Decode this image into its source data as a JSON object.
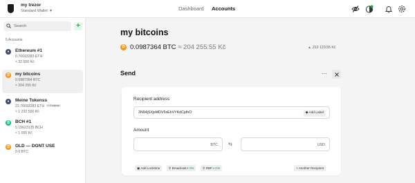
{
  "device": {
    "name": "my trezor",
    "wallet": "Standard Wallet"
  },
  "nav": {
    "dashboard": "Dashboard",
    "accounts": "Accounts"
  },
  "icons": {
    "topbar": [
      "hide-balances-icon",
      "tor-icon",
      "notifications-bell-icon",
      "settings-gear-icon"
    ],
    "search": "search-icon",
    "close": "close-icon"
  },
  "sidebar": {
    "search_placeholder": "Search",
    "add_label": "+",
    "accounts_count": "5 Accounts",
    "accounts": [
      {
        "name": "Ethereum #1",
        "balance": "0.76693283 ETH",
        "fiat": "≈ 32 500 Kč",
        "coin": "ETH",
        "coin_symbol": "♦",
        "color": "#454a75"
      },
      {
        "name": "my bitcoins",
        "balance": "0.0987364 BTC",
        "fiat": "≈ 204 255 Kč",
        "coin": "BTC",
        "coin_symbol": "₿",
        "color": "#f7931a"
      },
      {
        "name": "Meine Tokenss",
        "balance": "22.76693283 ETH",
        "badge": "+ 4 tokens",
        "fiat": "≈ 1 232 500 Kč",
        "coin": "ETH",
        "coin_symbol": "♦",
        "color": "#454a75"
      },
      {
        "name": "BCH #1",
        "balance": "0.15623135 BCH",
        "fiat": "≈ 1 000 Kč",
        "coin": "BCH",
        "coin_symbol": "₿",
        "color": "#0ac18e"
      },
      {
        "name": "OLD — DONT USE",
        "balance": "0.0 BTC",
        "coin": "BTC",
        "coin_symbol": "₿",
        "color": "#f7931a"
      }
    ]
  },
  "account": {
    "title": "my bitcoins",
    "balance": "0.0987364 BTC",
    "fiat": "≈ 204 255.55 Kč",
    "change": "212 123.55 Kč"
  },
  "send": {
    "title": "Send",
    "more": "⋯",
    "recipient_label": "Recipient address",
    "address": "3N94jSXjsMDV5xEhVYKdCjdhO",
    "add_label": "Add Label",
    "amount_label": "Amount",
    "amount_unit_crypto": "BTC",
    "amount_unit_fiat": "USD",
    "swap_symbol": "⇆",
    "options": {
      "locktime": "Add Locktime",
      "broadcast_label": "Broadcast",
      "broadcast_value": "ON",
      "rbf_label": "RBF",
      "rbf_value": "ON",
      "another_recipient": "+ Another Recipient"
    }
  },
  "colors": {
    "positive": "#2a9e45",
    "btc": "#f7931a",
    "eth": "#454a75",
    "bch": "#0ac18e"
  }
}
